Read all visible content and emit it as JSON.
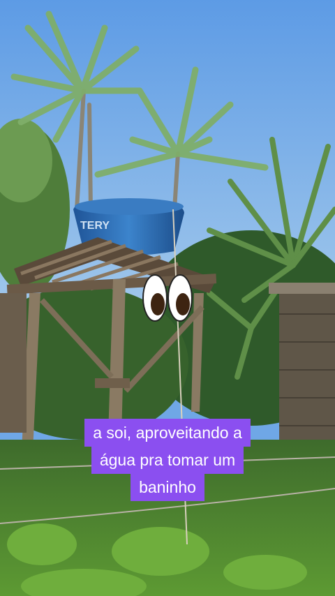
{
  "caption": {
    "lines": [
      "a soi, aproveitando a",
      "água pra tomar um",
      "baninho"
    ],
    "background": "#8b4ff0",
    "text_color": "#ffffff"
  },
  "scene": {
    "tank_label": "TERY",
    "palette": {
      "sky": "#72aae8",
      "tank": "#2f6fb5",
      "wood": "#7a6a55",
      "grass": "#4c8a2e"
    }
  }
}
